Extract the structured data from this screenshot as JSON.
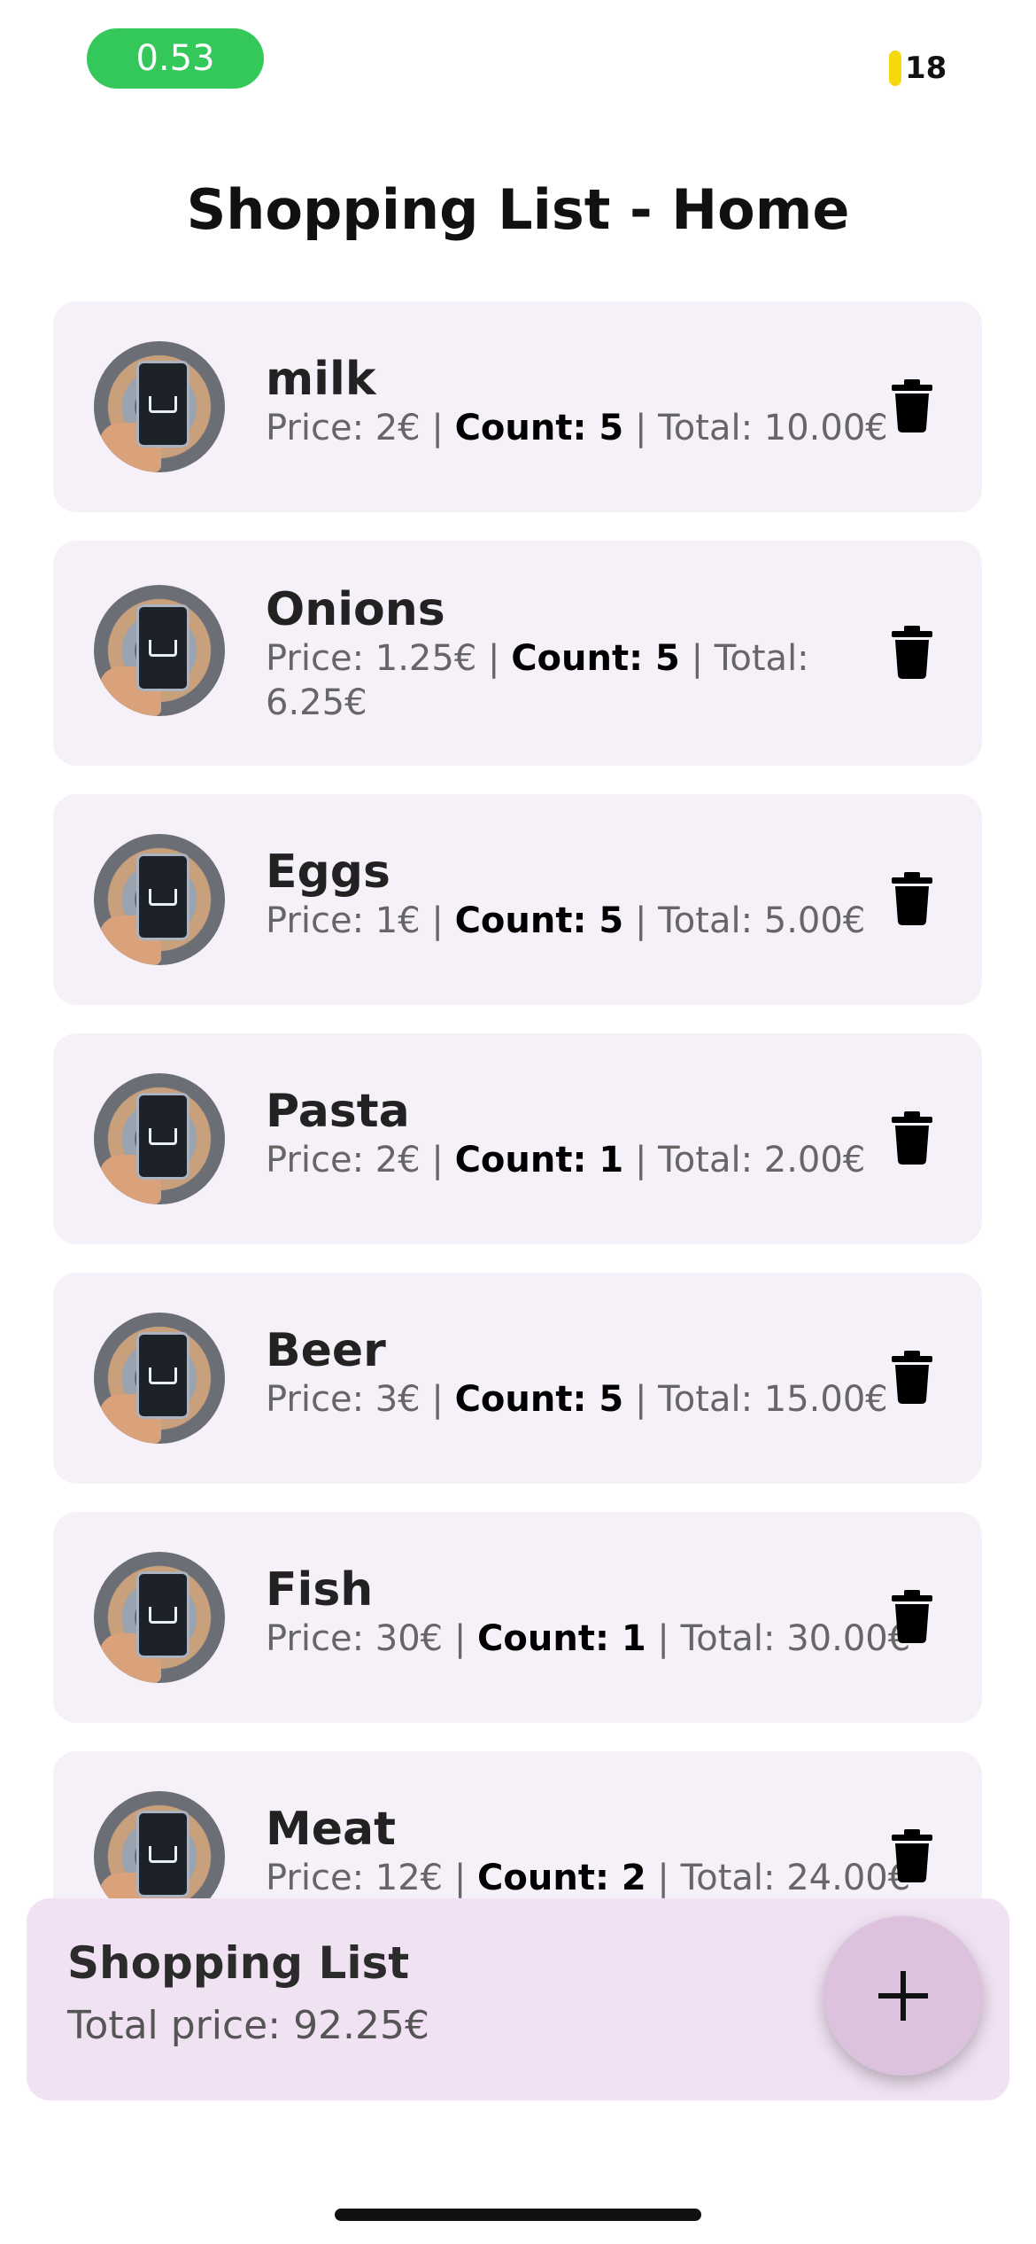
{
  "status": {
    "time": "0.53",
    "battery": "18",
    "colors": {
      "pill": "#34c759",
      "battery": "#f5d90a"
    }
  },
  "header": {
    "title": "Shopping List - Home"
  },
  "items": [
    {
      "name": "milk",
      "price": "Price: 2€ | ",
      "count": "Count: 5",
      "total": " | Total: 10.00€"
    },
    {
      "name": "Onions",
      "price": "Price: 1.25€ | ",
      "count": "Count: 5",
      "total": " | Total: 6.25€"
    },
    {
      "name": "Eggs",
      "price": "Price: 1€ | ",
      "count": "Count: 5",
      "total": " | Total: 5.00€"
    },
    {
      "name": "Pasta",
      "price": "Price: 2€ | ",
      "count": "Count: 1",
      "total": " | Total: 2.00€"
    },
    {
      "name": "Beer",
      "price": "Price: 3€ | ",
      "count": "Count: 5",
      "total": " | Total: 15.00€"
    },
    {
      "name": "Fish",
      "price": "Price: 30€ | ",
      "count": "Count: 1",
      "total": " | Total: 30.00€"
    },
    {
      "name": "Meat",
      "price": "Price: 12€ | ",
      "count": "Count: 2",
      "total": " | Total: 24.00€"
    }
  ],
  "item_icons": {
    "avatar": "shopping-cart-phone-image",
    "delete": "trash-icon"
  },
  "summary": {
    "title": "Shopping List",
    "total": "Total price: 92.25€"
  },
  "fab": {
    "label": "+",
    "icon": "plus-icon"
  },
  "theme": {
    "card_bg": "#f6f1f8",
    "summary_bg": "#f1e2f3",
    "fab_bg": "#dcc2dc"
  }
}
